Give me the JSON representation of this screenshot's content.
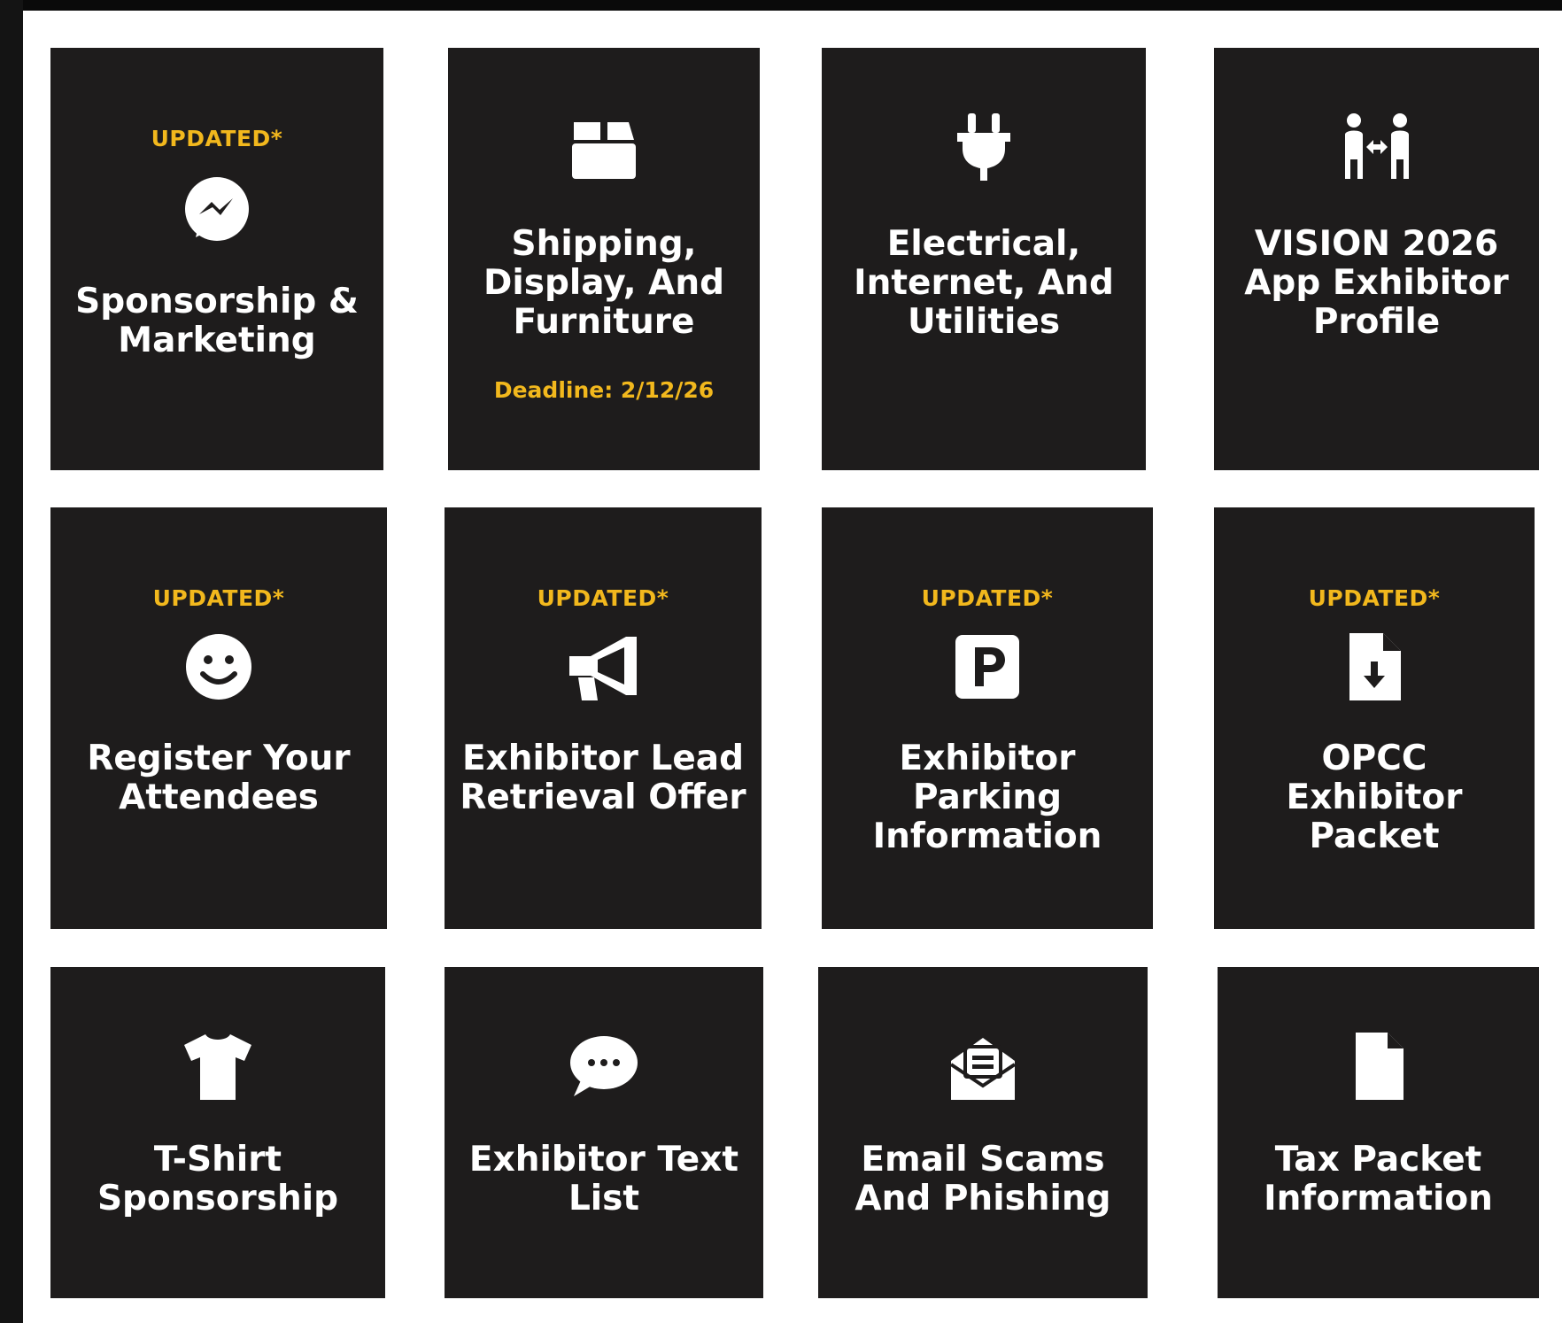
{
  "colors": {
    "tile_bg": "#1e1c1c",
    "accent": "#f2b81d",
    "page_bg": "#ffffff",
    "text": "#ffffff"
  },
  "tiles": [
    {
      "badge": "UPDATED*",
      "icon": "messenger-icon",
      "title": "Sponsorship &\nMarketing"
    },
    {
      "icon": "box-icon",
      "title": "Shipping,\nDisplay, And\nFurniture",
      "note": "Deadline: 2/12/26"
    },
    {
      "icon": "plug-icon",
      "title": "Electrical,\nInternet, And\nUtilities"
    },
    {
      "icon": "people-exchange-icon",
      "title": "VISION 2026\nApp Exhibitor\nProfile"
    },
    {
      "badge": "UPDATED*",
      "icon": "smile-icon",
      "title": "Register Your\nAttendees"
    },
    {
      "badge": "UPDATED*",
      "icon": "megaphone-icon",
      "title": "Exhibitor Lead\nRetrieval Offer"
    },
    {
      "badge": "UPDATED*",
      "icon": "parking-icon",
      "title": "Exhibitor\nParking\nInformation"
    },
    {
      "badge": "UPDATED*",
      "icon": "file-download-icon",
      "title": "OPCC\nExhibitor\nPacket"
    },
    {
      "icon": "tshirt-icon",
      "title": "T-Shirt\nSponsorship"
    },
    {
      "icon": "chat-bubble-icon",
      "title": "Exhibitor Text\nList"
    },
    {
      "icon": "envelope-open-icon",
      "title": "Email Scams\nAnd Phishing"
    },
    {
      "icon": "file-icon",
      "title": "Tax Packet\nInformation"
    }
  ]
}
